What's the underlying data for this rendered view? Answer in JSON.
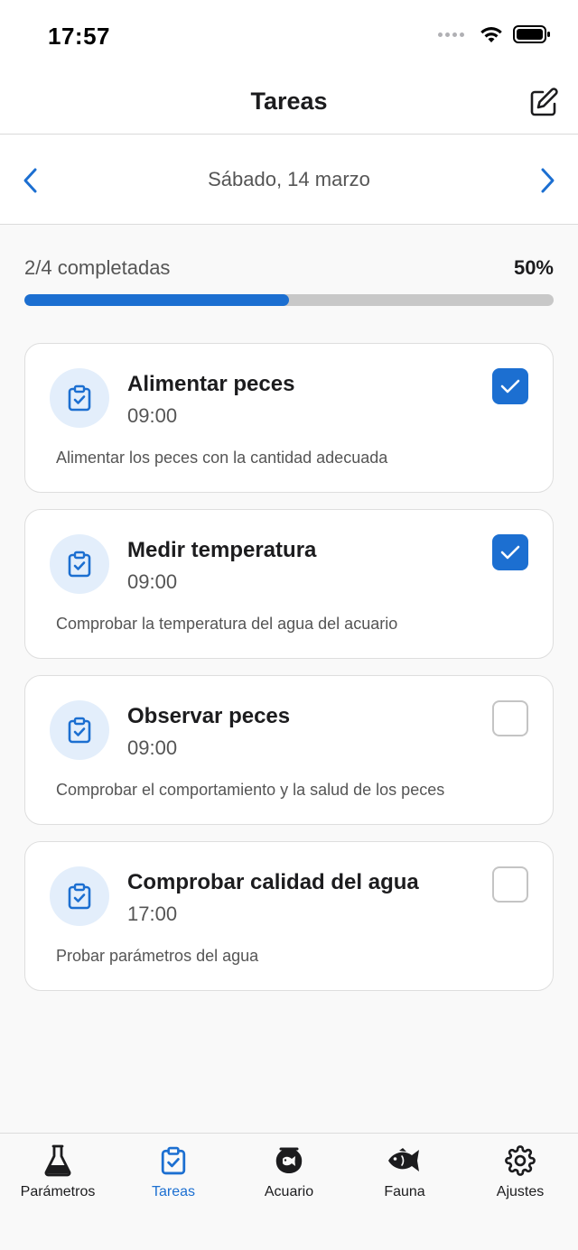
{
  "status_bar": {
    "time": "17:57"
  },
  "nav": {
    "title": "Tareas"
  },
  "date_nav": {
    "date": "Sábado, 14 marzo"
  },
  "progress": {
    "label": "2/4 completadas",
    "percent_label": "50%",
    "fraction": 0.5
  },
  "tasks": [
    {
      "title": "Alimentar peces",
      "time": "09:00",
      "description": "Alimentar los peces con la cantidad adecuada",
      "completed": true
    },
    {
      "title": "Medir temperatura",
      "time": "09:00",
      "description": "Comprobar la temperatura del agua del acuario",
      "completed": true
    },
    {
      "title": "Observar peces",
      "time": "09:00",
      "description": "Comprobar el comportamiento y la salud de los peces",
      "completed": false
    },
    {
      "title": "Comprobar calidad del agua",
      "time": "17:00",
      "description": "Probar parámetros del agua",
      "completed": false
    }
  ],
  "tab_bar": {
    "items": [
      {
        "label": "Parámetros",
        "icon": "flask-icon",
        "active": false
      },
      {
        "label": "Tareas",
        "icon": "clipboard-check-icon",
        "active": true
      },
      {
        "label": "Acuario",
        "icon": "fishbowl-icon",
        "active": false
      },
      {
        "label": "Fauna",
        "icon": "fish-icon",
        "active": false
      },
      {
        "label": "Ajustes",
        "icon": "gear-icon",
        "active": false
      }
    ]
  },
  "colors": {
    "accent": "#1c6fd1",
    "icon_bg": "#e3eefb",
    "track": "#c8c8c8"
  }
}
